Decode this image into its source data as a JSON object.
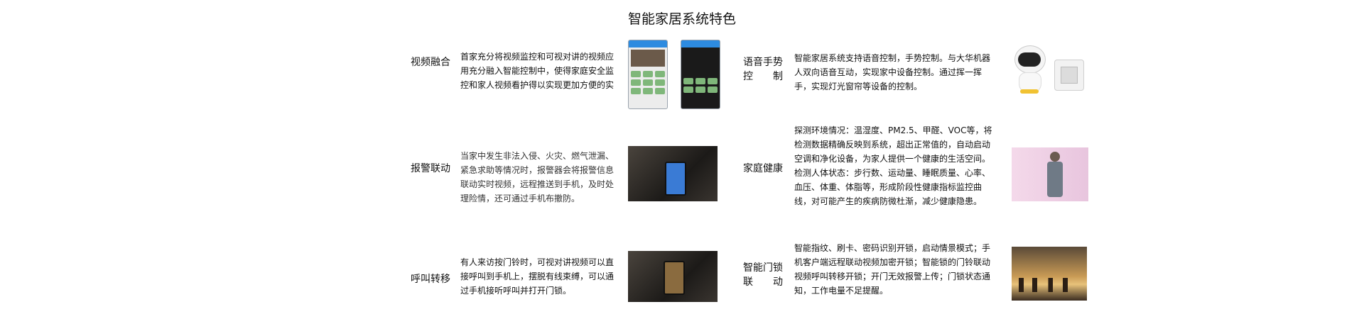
{
  "title": "智能家居系统特色",
  "features": [
    {
      "label": "视频融合",
      "desc_lines": [
        "首家充分将视频监控和可视对讲的视频应",
        "用充分融入智能控制中，使得家庭安全监",
        "控和家人视频看护得以实现更加方便的实"
      ]
    },
    {
      "label_line1": "语音手势",
      "label_line2": "控 制",
      "desc_lines": [
        "智能家居系统支持语音控制，手势控制。与大华机器",
        "人双向语音互动，实现家中设备控制。通过挥一挥",
        "手，实现灯光窗帘等设备的控制。"
      ]
    },
    {
      "label": "报警联动",
      "desc_lines": [
        "当家中发生非法入侵、火灾、燃气泄漏、",
        "紧急求助等情况时，报警器会将报警信息",
        "联动实时视频，远程推送到手机，及时处",
        "理险情，还可通过手机布撤防。"
      ]
    },
    {
      "label": "家庭健康",
      "desc_lines": [
        "探测环境情况：温湿度、PM2.5、甲醛、VOC等，将",
        "检测数据精确反映到系统，超出正常值的，自动启动",
        "空调和净化设备，为家人提供一个健康的生活空间。",
        "检测人体状态：步行数、运动量、睡眠质量、心率、",
        "血压、体重、体脂等，形成阶段性健康指标监控曲",
        "线，对可能产生的疾病防微杜渐，减少健康隐患。"
      ]
    },
    {
      "label": "呼叫转移",
      "desc_lines": [
        "有人来访按门铃时，可视对讲视频可以直",
        "接呼叫到手机上，摆脱有线束缚，可以通",
        "过手机接听呼叫并打开门锁。"
      ]
    },
    {
      "label_line1": "智能门锁",
      "label_line2": "联 动",
      "desc_lines": [
        "智能指纹、刷卡、密码识别开锁，启动情景模式；手",
        "机客户端远程联动视频加密开锁；智能锁的门铃联动",
        "视频呼叫转移开锁；开门无效报警上传；门锁状态通",
        "知，工作电量不足提醒。"
      ]
    }
  ]
}
